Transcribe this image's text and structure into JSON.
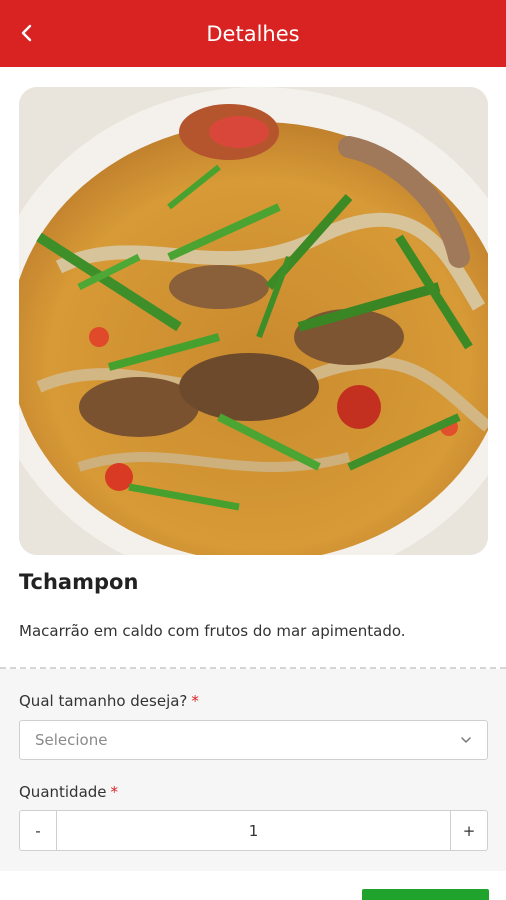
{
  "header": {
    "title": "Detalhes",
    "back_icon": "chevron-left-icon",
    "background_color": "#d92323"
  },
  "product": {
    "name": "Tchampon",
    "description": "Macarrão em caldo com frutos do mar apimentado."
  },
  "options": {
    "size": {
      "label": "Qual tamanho deseja?",
      "required_mark": "*",
      "placeholder": "Selecione"
    },
    "quantity": {
      "label": "Quantidade",
      "required_mark": "*",
      "minus_label": "-",
      "value": "1",
      "plus_label": "+"
    }
  },
  "footer": {
    "button_color": "#1fa32c"
  }
}
